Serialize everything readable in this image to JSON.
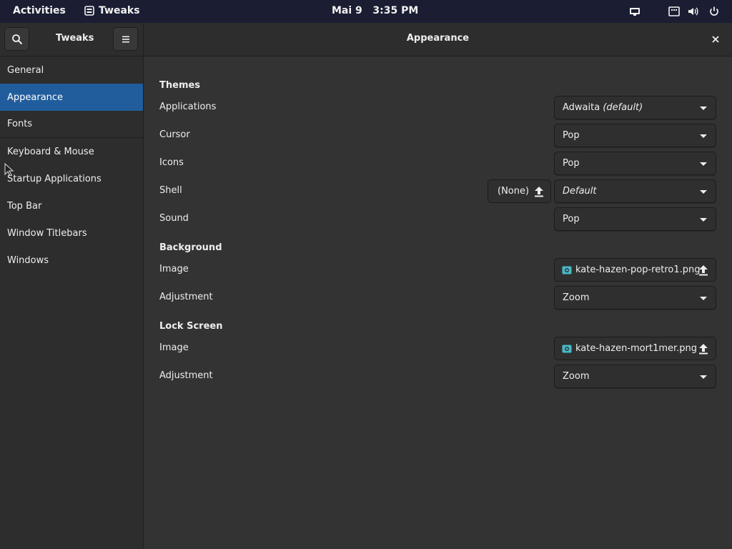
{
  "topbar": {
    "activities": "Activities",
    "app_name": "Tweaks",
    "clock": "Mai 9   3:35 PM",
    "icons": [
      "display-icon",
      "keyboard-layout-icon",
      "volume-icon",
      "power-icon"
    ]
  },
  "header": {
    "sidebar_title": "Tweaks",
    "main_title": "Appearance",
    "search_icon": "search-icon",
    "menu_icon": "hamburger-menu-icon",
    "close_icon": "close-icon"
  },
  "sidebar": {
    "items": [
      {
        "label": "General",
        "selected": false
      },
      {
        "label": "Appearance",
        "selected": true
      },
      {
        "label": "Fonts",
        "selected": false
      },
      {
        "label": "Keyboard & Mouse",
        "selected": false
      },
      {
        "label": "Startup Applications",
        "selected": false
      },
      {
        "label": "Top Bar",
        "selected": false
      },
      {
        "label": "Window Titlebars",
        "selected": false
      },
      {
        "label": "Windows",
        "selected": false
      }
    ]
  },
  "themes": {
    "title": "Themes",
    "applications": {
      "label": "Applications",
      "value": "Adwaita",
      "value_note": "(default)"
    },
    "cursor": {
      "label": "Cursor",
      "value": "Pop"
    },
    "icons": {
      "label": "Icons",
      "value": "Pop"
    },
    "shell": {
      "label": "Shell",
      "file_value": "(None)",
      "value": "Default"
    },
    "sound": {
      "label": "Sound",
      "value": "Pop"
    }
  },
  "background": {
    "title": "Background",
    "image": {
      "label": "Image",
      "value": "kate-hazen-pop-retro1.png"
    },
    "adjustment": {
      "label": "Adjustment",
      "value": "Zoom"
    }
  },
  "lock_screen": {
    "title": "Lock Screen",
    "image": {
      "label": "Image",
      "value": "kate-hazen-mort1mer.png"
    },
    "adjustment": {
      "label": "Adjustment",
      "value": "Zoom"
    }
  },
  "colors": {
    "topbar_bg": "#1b1d33",
    "accent_selected": "#215d9c",
    "content_bg": "#333333",
    "sidebar_bg": "#2d2d2d",
    "image_icon": "#48b9c7"
  }
}
